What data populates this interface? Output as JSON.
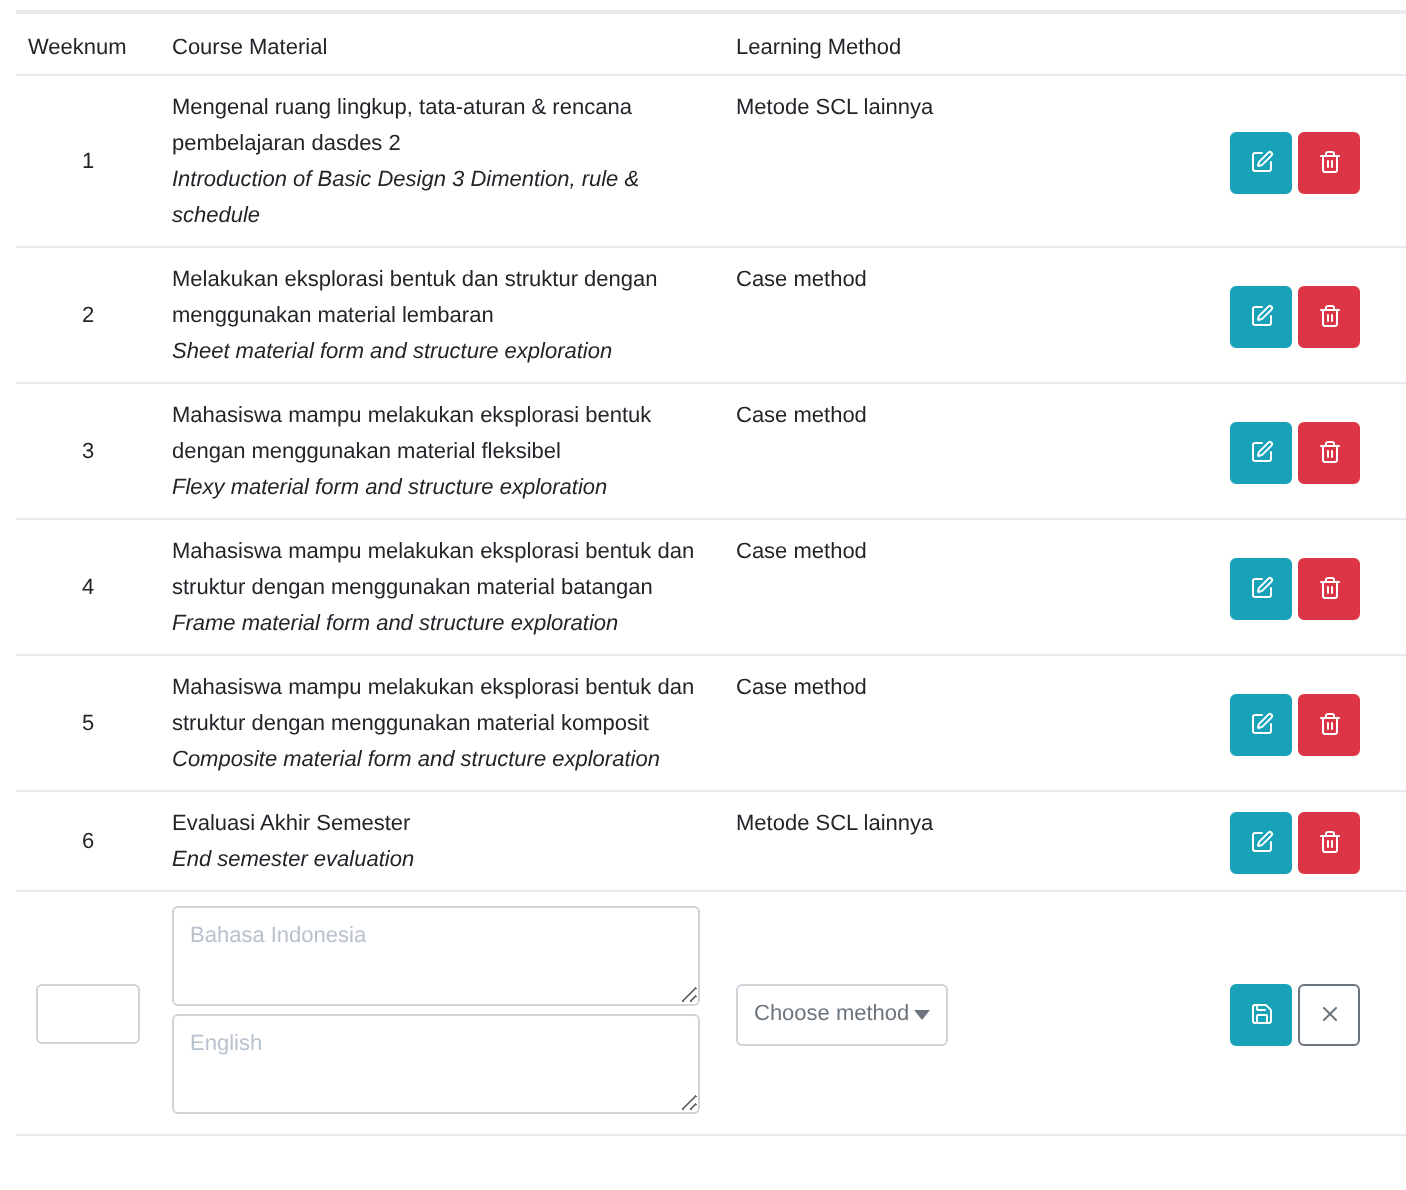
{
  "table": {
    "columns": [
      "Weeknum",
      "Course Material",
      "Learning Method"
    ],
    "rows": [
      {
        "week": "1",
        "material": "Mengenal ruang lingkup, tata-aturan & rencana pembelajaran dasdes 2",
        "material_en": "Introduction of Basic Design 3 Dimention, rule & schedule",
        "method": "Metode SCL lainnya"
      },
      {
        "week": "2",
        "material": "Melakukan eksplorasi bentuk dan struktur dengan menggunakan material lembaran",
        "material_en": "Sheet material form and structure exploration",
        "method": "Case method"
      },
      {
        "week": "3",
        "material": "Mahasiswa mampu melakukan eksplorasi bentuk dengan menggunakan material fleksibel",
        "material_en": "Flexy material form and structure exploration",
        "method": "Case method"
      },
      {
        "week": "4",
        "material": "Mahasiswa mampu melakukan eksplorasi bentuk dan struktur dengan menggunakan material batangan",
        "material_en": "Frame material form and structure exploration",
        "method": "Case method"
      },
      {
        "week": "5",
        "material": "Mahasiswa mampu melakukan eksplorasi bentuk dan struktur dengan menggunakan material komposit",
        "material_en": "Composite material form and structure exploration",
        "method": "Case method"
      },
      {
        "week": "6",
        "material": "Evaluasi Akhir Semester",
        "material_en": "End semester evaluation",
        "method": "Metode SCL lainnya"
      }
    ]
  },
  "new_row": {
    "material_placeholder": "Bahasa Indonesia",
    "material_en_placeholder": "English",
    "method_select": "Choose method"
  }
}
